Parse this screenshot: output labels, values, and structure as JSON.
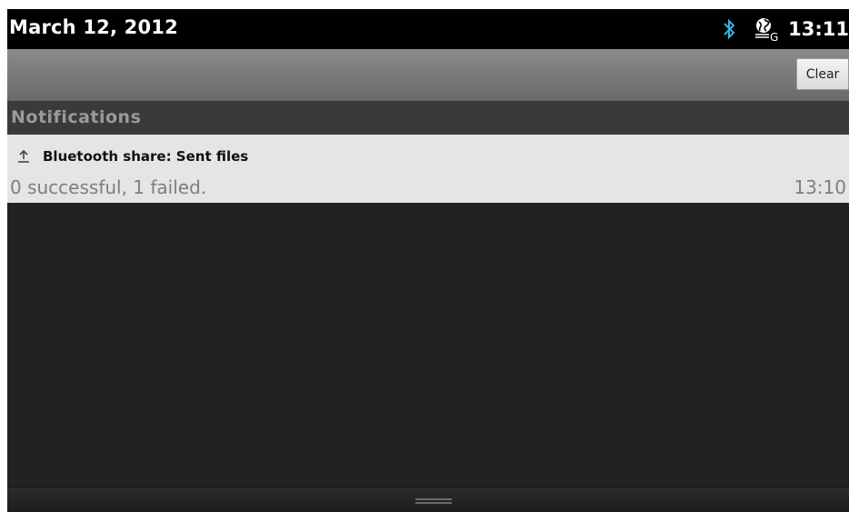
{
  "status_bar": {
    "date": "March 12, 2012",
    "time": "13:11",
    "icons": [
      "bluetooth-icon",
      "gps-sync-icon"
    ]
  },
  "action_bar": {
    "clear_label": "Clear"
  },
  "section": {
    "title": "Notifications"
  },
  "notifications": [
    {
      "icon": "upload-icon",
      "title": "Bluetooth share: Sent files",
      "text": "0 successful, 1 failed.",
      "time": "13:10"
    }
  ],
  "colors": {
    "status_bar_bg": "#000000",
    "bluetooth_blue": "#33b5e5",
    "notification_bg": "#e5e5e5",
    "panel_bg": "#222222"
  }
}
